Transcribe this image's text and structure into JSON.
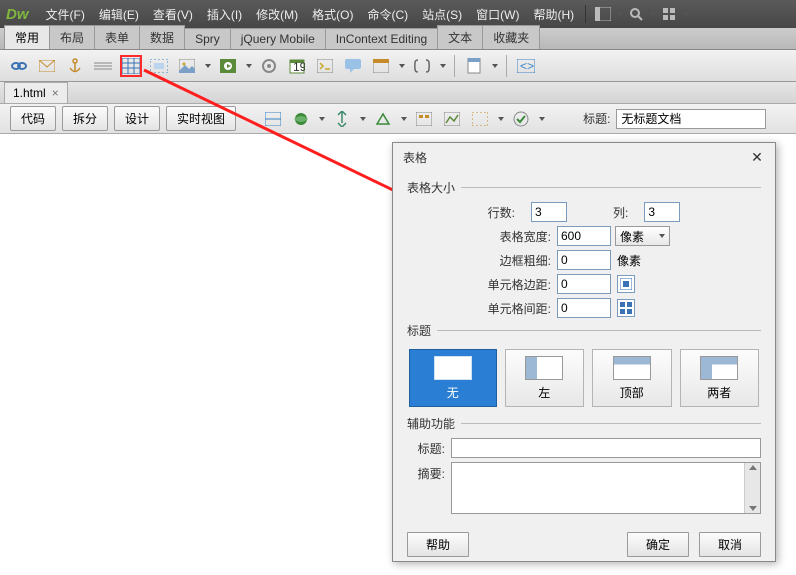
{
  "menubar": {
    "items": [
      "文件(F)",
      "编辑(E)",
      "查看(V)",
      "插入(I)",
      "修改(M)",
      "格式(O)",
      "命令(C)",
      "站点(S)",
      "窗口(W)",
      "帮助(H)"
    ]
  },
  "category_tabs": [
    "常用",
    "布局",
    "表单",
    "数据",
    "Spry",
    "jQuery Mobile",
    "InContext Editing",
    "文本",
    "收藏夹"
  ],
  "active_category": 0,
  "doc_tab": {
    "name": "1.html"
  },
  "view_buttons": [
    "代码",
    "拆分",
    "设计",
    "实时视图"
  ],
  "title_label": "标题:",
  "title_value": "无标题文档",
  "dialog": {
    "title": "表格",
    "group_size": "表格大小",
    "rows_label": "行数:",
    "rows": "3",
    "cols_label": "列:",
    "cols": "3",
    "width_label": "表格宽度:",
    "width": "600",
    "unit_px": "像素",
    "border_label": "边框粗细:",
    "border": "0",
    "cellpadding_label": "单元格边距:",
    "cellpadding": "0",
    "cellspacing_label": "单元格间距:",
    "cellspacing": "0",
    "group_header": "标题",
    "hopts": [
      "无",
      "左",
      "顶部",
      "两者"
    ],
    "group_access": "辅助功能",
    "caption_label": "标题:",
    "summary_label": "摘要:",
    "btn_help": "帮助",
    "btn_ok": "确定",
    "btn_cancel": "取消"
  }
}
